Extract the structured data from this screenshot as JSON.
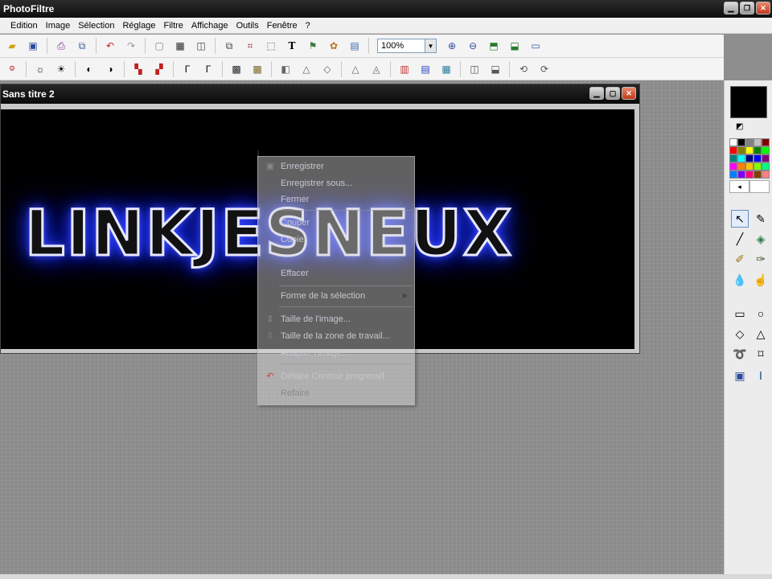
{
  "app": {
    "title": "PhotoFiltre"
  },
  "menubar": {
    "items": [
      "Edition",
      "Image",
      "Sélection",
      "Réglage",
      "Filtre",
      "Affichage",
      "Outils",
      "Fenêtre",
      "?"
    ]
  },
  "toolbar1": {
    "zoom_value": "100%",
    "icons": [
      "open-icon",
      "save-icon",
      "print-icon",
      "scanner-icon",
      "undo-icon",
      "redo-icon",
      "paste-icon",
      "film-icon",
      "transform-icon",
      "copy-doc-icon",
      "crop-icon",
      "text-icon",
      "layers-icon",
      "plugin-icon",
      "window-icon"
    ],
    "zoom_icons": [
      "zoom-in-icon",
      "zoom-out-icon",
      "fit-icon",
      "fullscreen-icon",
      "display-icon"
    ]
  },
  "toolbar2": {
    "icons": [
      "auto-level-icon",
      "brightness-plus-icon",
      "brightness-minus-icon",
      "contrast-plus-icon",
      "contrast-minus-icon",
      "saturation-plus-icon",
      "saturation-minus-icon",
      "gamma-plus-icon",
      "gamma-minus-icon",
      "filter-a-icon",
      "filter-b-icon",
      "filter-c-icon",
      "blur-icon",
      "sharpen-icon",
      "relief-icon",
      "emboss-icon",
      "gradient-icon",
      "sky-icon",
      "noise-icon",
      "flip-h-icon",
      "flip-v-icon",
      "rotate-left-icon",
      "rotate-right-icon"
    ]
  },
  "document": {
    "title": "Sans titre 2",
    "canvas_text": "LINKJESNEUX"
  },
  "context_menu": {
    "items": [
      {
        "label": "Enregistrer",
        "icon": "save-icon"
      },
      {
        "label": "Enregistrer sous..."
      },
      {
        "label": "Fermer"
      },
      {
        "label": "Couper"
      },
      {
        "label": "Copier"
      },
      {
        "label": "Effacer"
      },
      {
        "label": "Forme de la sélection",
        "submenu": true
      },
      {
        "label": "Taille de l'image...",
        "icon": "resize-icon"
      },
      {
        "label": "Taille de la zone de travail...",
        "icon": "canvas-size-icon"
      },
      {
        "label": "Adapter l'image..."
      },
      {
        "label": "Défaire Contour progressif",
        "icon": "undo-icon"
      },
      {
        "label": "Refaire"
      }
    ]
  },
  "colors": {
    "foreground": "#000000",
    "neon_glow": "#1a2cff",
    "palette": [
      "#ffffff",
      "#000000",
      "#808080",
      "#c0c0c0",
      "#800000",
      "#ff0000",
      "#808000",
      "#ffff00",
      "#008000",
      "#00ff00",
      "#008080",
      "#00ffff",
      "#000080",
      "#0000ff",
      "#800080",
      "#ff00ff",
      "#ff8000",
      "#ffc000",
      "#80ff00",
      "#00ff80",
      "#0080ff",
      "#8000ff",
      "#ff0080",
      "#804000",
      "#ff8080"
    ]
  },
  "tools": [
    "selection-arrow-icon",
    "eyedropper-icon",
    "line-icon",
    "fill-bucket-icon",
    "brush-icon",
    "spray-icon",
    "blur-drop-icon",
    "smudge-icon",
    "rectangle-icon",
    "ellipse-icon",
    "diamond-icon",
    "triangle-icon",
    "lasso-icon",
    "polygon-lasso-icon",
    "horizontal-select-icon",
    "vertical-select-icon"
  ]
}
